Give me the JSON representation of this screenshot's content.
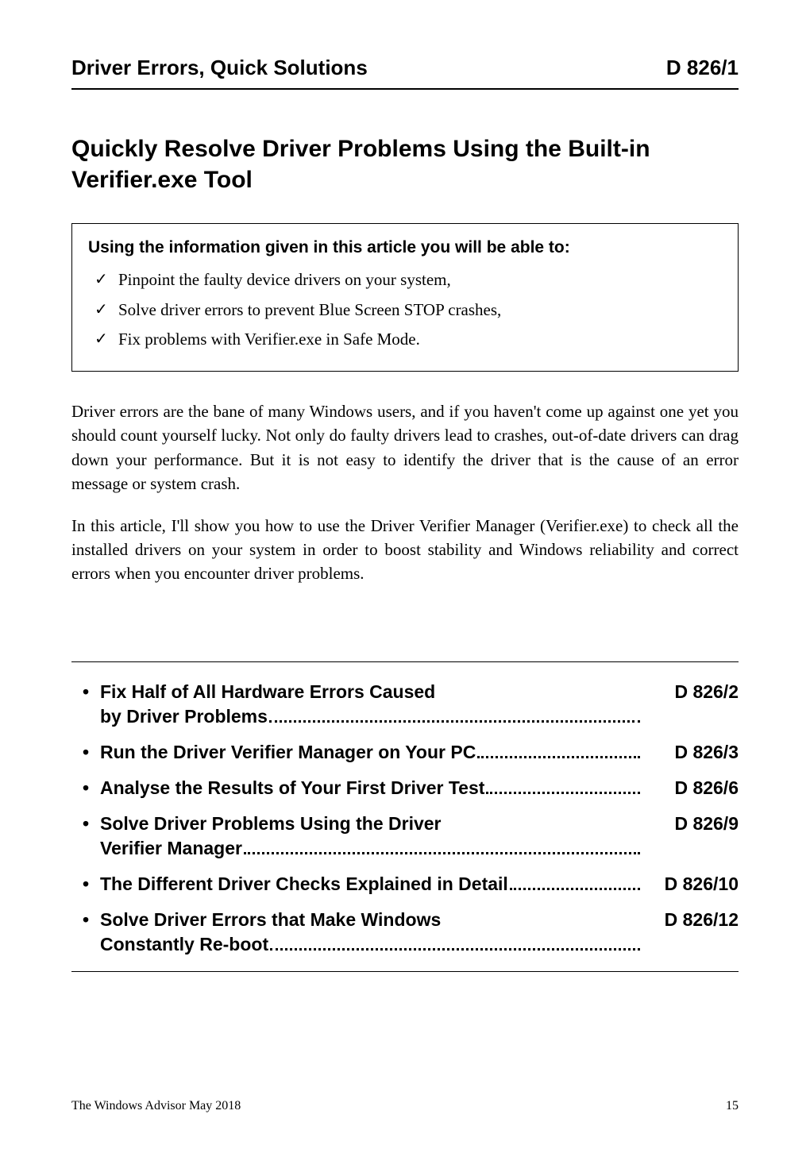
{
  "header": {
    "left": "Driver Errors, Quick Solutions",
    "right": "D 826/1"
  },
  "title": "Quickly Resolve Driver Problems Using the Built-in Verifier.exe Tool",
  "infobox": {
    "heading": "Using the information given in this article you will be able to:",
    "items": [
      "Pinpoint the faulty device drivers on your system,",
      "Solve driver errors to prevent Blue Screen STOP crashes,",
      "Fix problems with Verifier.exe in Safe Mode."
    ]
  },
  "paragraphs": [
    "Driver errors are the bane of many Windows users, and if you haven't come up against one yet you should count yourself lucky. Not only do faulty drivers lead to crashes, out-of-date drivers can drag down your performance. But it is not easy to identify the driver that is the cause of an error message or system crash.",
    "In this article, I'll show you how to use the Driver Verifier Manager (Verifier.exe) to check all the installed drivers on your system in order to boost stability and Windows reliability and correct errors when you encounter driver problems."
  ],
  "toc": [
    {
      "label_line1": "Fix Half of All Hardware Errors Caused",
      "label_line2": "by Driver Problems",
      "page": "D 826/2"
    },
    {
      "label_line1": "Run the Driver Verifier Manager on Your PC",
      "label_line2": "",
      "page": "D 826/3"
    },
    {
      "label_line1": "Analyse the Results of Your First Driver Test",
      "label_line2": "",
      "page": "D 826/6"
    },
    {
      "label_line1": "Solve Driver Problems Using the Driver",
      "label_line2": "Verifier Manager",
      "page": "D 826/9"
    },
    {
      "label_line1": "The Different Driver Checks Explained in Detail",
      "label_line2": "",
      "page": "D 826/10"
    },
    {
      "label_line1": "Solve Driver Errors that Make Windows",
      "label_line2": "Constantly Re-boot",
      "page": "D 826/12"
    }
  ],
  "footer": {
    "left": "The Windows Advisor   May 2018",
    "right": "15"
  }
}
